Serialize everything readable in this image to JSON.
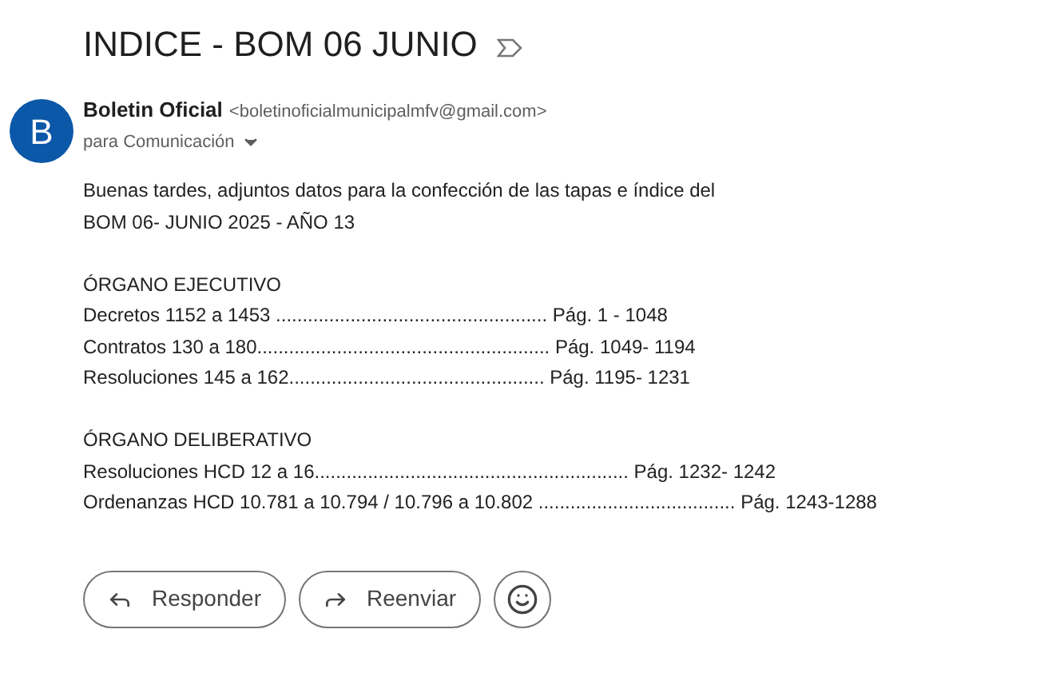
{
  "subject": "INDICE - BOM 06 JUNIO",
  "sender": {
    "initial": "B",
    "name": "Boletin Oficial",
    "email": "<boletinoficialmunicipalmfv@gmail.com>",
    "recipients": "para Comunicación"
  },
  "body": {
    "intro": [
      "Buenas tardes, adjuntos datos para la confección de las tapas e índice del",
      "BOM 06- JUNIO 2025 - AÑO 13"
    ],
    "sections": [
      {
        "heading": "ÓRGANO EJECUTIVO",
        "entries": [
          "Decretos 1152 a 1453 ................................................... Pág. 1 - 1048",
          "Contratos 130 a 180....................................................... Pág. 1049- 1194",
          "Resoluciones 145 a 162................................................ Pág. 1195- 1231"
        ]
      },
      {
        "heading": "ÓRGANO DELIBERATIVO",
        "entries": [
          "Resoluciones HCD 12 a 16........................................................... Pág. 1232- 1242",
          "Ordenanzas HCD 10.781 a 10.794 / 10.796 a 10.802 ..................................... Pág. 1243-1288"
        ]
      }
    ]
  },
  "actions": [
    {
      "kind": "reply",
      "label": "Responder"
    },
    {
      "kind": "forward",
      "label": "Reenviar"
    },
    {
      "kind": "emoji"
    }
  ]
}
